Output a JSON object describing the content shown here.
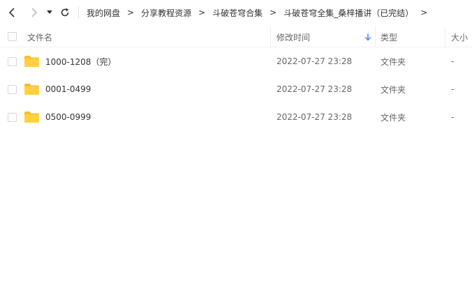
{
  "toolbar": {
    "back_icon": "chevron-left-icon",
    "forward_icon": "chevron-right-icon",
    "history_icon": "caret-down-icon",
    "refresh_icon": "refresh-icon"
  },
  "breadcrumb": {
    "items": [
      "我的网盘",
      "分享教程资源",
      "斗破苍穹合集",
      "斗破苍穹全集_桑梓播讲（已完结）"
    ],
    "separator": ">"
  },
  "header": {
    "name": "文件名",
    "modified": "修改时间",
    "type": "类型",
    "size": "大小"
  },
  "colors": {
    "folder": "#ffd140",
    "folder_dark": "#f5c02b",
    "sort_arrow": "#3b8cf5"
  },
  "files": [
    {
      "name": "1000-1208（完）",
      "modified": "2022-07-27 23:28",
      "type": "文件夹",
      "size": "-"
    },
    {
      "name": "0001-0499",
      "modified": "2022-07-27 23:28",
      "type": "文件夹",
      "size": "-"
    },
    {
      "name": "0500-0999",
      "modified": "2022-07-27 23:28",
      "type": "文件夹",
      "size": "-"
    }
  ]
}
